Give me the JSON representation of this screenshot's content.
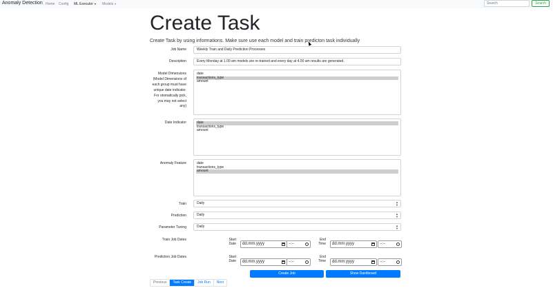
{
  "navbar": {
    "brand": "Anomaly Detection",
    "links": [
      "Home",
      "Config",
      "ML Executor",
      "Models"
    ],
    "search_placeholder": "Search",
    "search_button": "Search"
  },
  "page": {
    "title": "Create Task",
    "lead": "Create Task by using informations. Make sure use each model and train predicton task individually"
  },
  "form": {
    "job_name_label": "Job Name",
    "job_name_value": "Weekly Train and Daily Prediction Processes",
    "description_label": "Description",
    "description_value": "Every Monday at 1.00 am  models are re-trained and every day at 4.00 am results are generated.",
    "model_dimensions_label": "Model Dimensions (Model Dimensions of each group must have unique date indicator. For otomatically pick, you may not select any)",
    "model_dimensions_options": [
      "date",
      "transactions_type",
      "amount"
    ],
    "model_dimensions_selected": "transactions_type",
    "date_indicator_label": "Date Indicator",
    "date_indicator_options": [
      "date",
      "transactions_type",
      "amount"
    ],
    "date_indicator_selected": "date",
    "anomaly_feature_label": "Anomaly Feature",
    "anomaly_feature_options": [
      "date",
      "transactions_type",
      "amount"
    ],
    "anomaly_feature_selected": "amount",
    "train_label": "Train",
    "train_value": "Daily",
    "prediction_label": "Prediction",
    "prediction_value": "Daily",
    "tuning_label": "Parameter Tuning",
    "tuning_value": "Daily",
    "train_dates_label": "Train Job Dates",
    "prediction_dates_label": "Prediction Job Dates",
    "start_date_label": "Start Date",
    "end_time_label": "End Time",
    "date_placeholder": "dd.mm.yyyy",
    "time_placeholder": "--:--"
  },
  "buttons": {
    "create_job": "Create Job",
    "show_dashboard": "Show Dashboard"
  },
  "pagination": [
    "Previous",
    "Task Create",
    "Job Run",
    "Next"
  ]
}
